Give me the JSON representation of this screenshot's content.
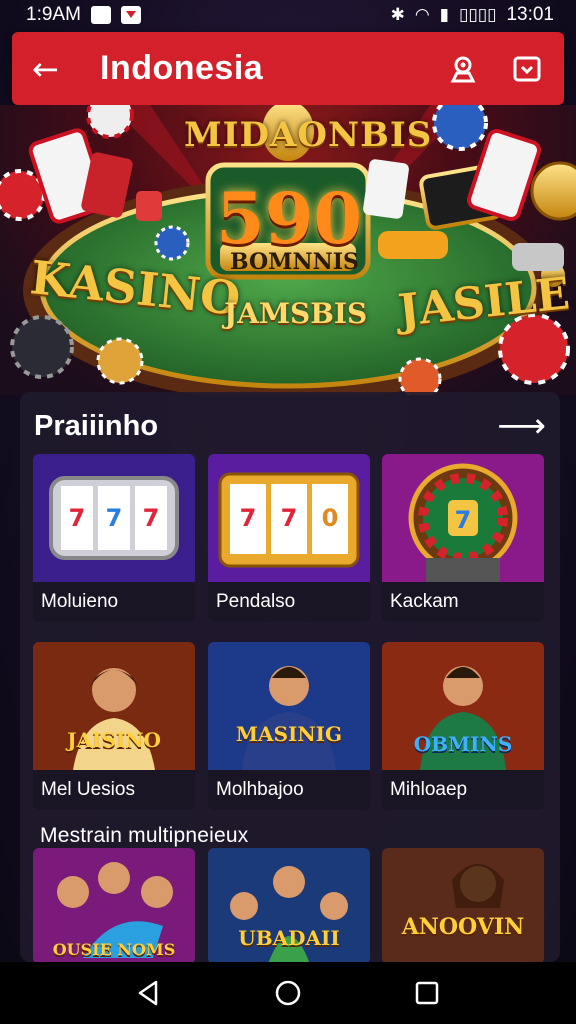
{
  "status_bar": {
    "time_left": "1:9AM",
    "time_right": "13:01",
    "battery_label": "▯▯▯▯"
  },
  "app_bar": {
    "title": "Indonesia",
    "back_icon": "arrow-left-icon",
    "action_icons": [
      "settings-badge-icon",
      "message-square-icon"
    ]
  },
  "hero": {
    "top_text": "MIDAONBIS",
    "bonus_value": "590",
    "bonus_label": "BOMNNIS",
    "left_text": "KASINO",
    "center_text": "JAMSBIS",
    "right_text": "JASILE"
  },
  "section": {
    "title": "Praiiinho",
    "see_all_icon": "arrow-right-icon"
  },
  "cards": [
    {
      "label": "Moluieno",
      "theme": "slot-reels-purple"
    },
    {
      "label": "Pendalso",
      "theme": "slot-reels-gold"
    },
    {
      "label": "Kackam",
      "theme": "roulette"
    },
    {
      "label": "Mel Uesios",
      "theme": "casino-woman",
      "art_text": "JAISINO"
    },
    {
      "label": "Molhbajoo",
      "theme": "casino-man",
      "art_text": "MASINIG"
    },
    {
      "label": "Mihloaep",
      "theme": "casino-man-green",
      "art_text": "OBMINS"
    }
  ],
  "sub_section": {
    "title": "Mestrain  multipneieux"
  },
  "partial_cards": [
    {
      "theme": "group-players",
      "art_text": "OUSIE NOMS"
    },
    {
      "theme": "players-crowd",
      "art_text": "UBADAII"
    },
    {
      "theme": "woman-stage",
      "art_text": "ANOOVIN"
    }
  ],
  "nav_bar": {
    "buttons": [
      "back-triangle-icon",
      "home-circle-icon",
      "recents-square-icon"
    ]
  },
  "colors": {
    "app_bar": "#d4202b",
    "panel": "#201a2c",
    "gold": "#f4c542"
  }
}
